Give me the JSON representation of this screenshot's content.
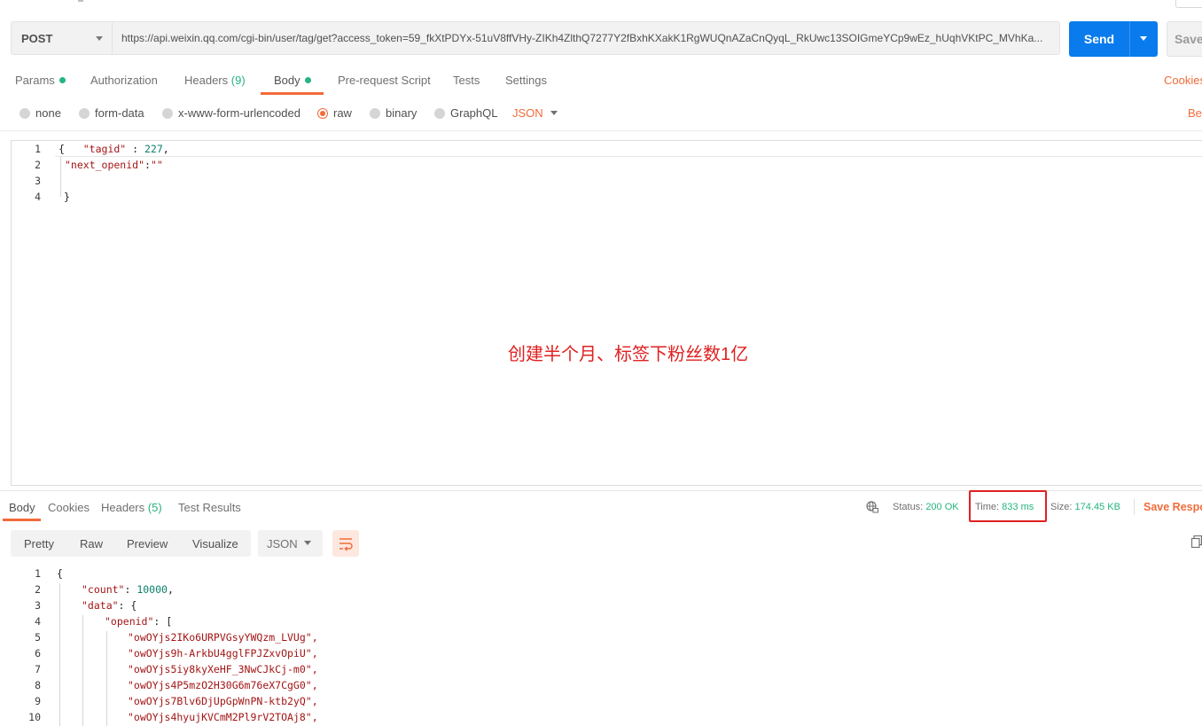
{
  "request": {
    "method": "POST",
    "url": "https://api.weixin.qq.com/cgi-bin/user/tag/get?access_token=59_fkXtPDYx-51uV8ffVHy-ZIKh4ZlthQ7277Y2fBxhKXakK1RgWUQnAZaCnQyqL_RkUwc13SOIGmeYCp9wEz_hUqhVKtPC_MVhKa...",
    "send_label": "Send",
    "save_label": "Save"
  },
  "request_tabs": [
    {
      "label": "Params",
      "dot": true
    },
    {
      "label": "Authorization"
    },
    {
      "label": "Headers",
      "count": "(9)"
    },
    {
      "label": "Body",
      "dot": true,
      "active": true
    },
    {
      "label": "Pre-request Script"
    },
    {
      "label": "Tests"
    },
    {
      "label": "Settings"
    }
  ],
  "cookies_link": "Cookies",
  "body_types": [
    "none",
    "form-data",
    "x-www-form-urlencoded",
    "raw",
    "binary",
    "GraphQL"
  ],
  "body_type_selected": "raw",
  "body_format": "JSON",
  "beautify_link": "Bea",
  "request_body": {
    "line_numbers": [
      "1",
      "2",
      "3",
      "4"
    ],
    "l1_open": "{",
    "l1_key": "\"tagid\"",
    "l1_sep": " : ",
    "l1_val": "227",
    "l1_end": ",",
    "l2_key": "\"next_openid\"",
    "l2_sep": ":",
    "l2_val": "\"\"",
    "l4": "}"
  },
  "annotation": "创建半个月、标签下粉丝数1亿",
  "response_tabs": [
    {
      "label": "Body",
      "active": true
    },
    {
      "label": "Cookies"
    },
    {
      "label": "Headers",
      "count": "(5)"
    },
    {
      "label": "Test Results"
    }
  ],
  "response_meta": {
    "status_label": "Status:",
    "status_value": "200 OK",
    "time_label": "Time:",
    "time_value": "833 ms",
    "size_label": "Size:",
    "size_value": "174.45 KB",
    "save_response": "Save Respo"
  },
  "view_modes": [
    "Pretty",
    "Raw",
    "Preview",
    "Visualize"
  ],
  "response_format": "JSON",
  "response_body": {
    "line_numbers": [
      "1",
      "2",
      "3",
      "4",
      "5",
      "6",
      "7",
      "8",
      "9",
      "10"
    ],
    "l1": "{",
    "count_key": "\"count\"",
    "count_val": "10000",
    "data_key": "\"data\"",
    "data_open": ": {",
    "openid_key": "\"openid\"",
    "openid_open": ": [",
    "openids": [
      "\"owOYjs2IKo6URPVGsyYWQzm_LVUg\",",
      "\"owOYjs9h-ArkbU4gglFPJZxvOpiU\",",
      "\"owOYjs5iy8kyXeHF_3NwCJkCj-m0\",",
      "\"owOYjs4P5mzO2H30G6m76eX7CgG0\",",
      "\"owOYjs7Blv6DjUpGpWnPN-ktb2yQ\",",
      "\"owOYjs4hyujKVCmM2Pl9rV2TOAj8\","
    ]
  },
  "colors": {
    "accent": "#f26b3a",
    "send_blue": "#097bed",
    "success_green": "#26b47f",
    "highlight_red": "#e02020"
  }
}
